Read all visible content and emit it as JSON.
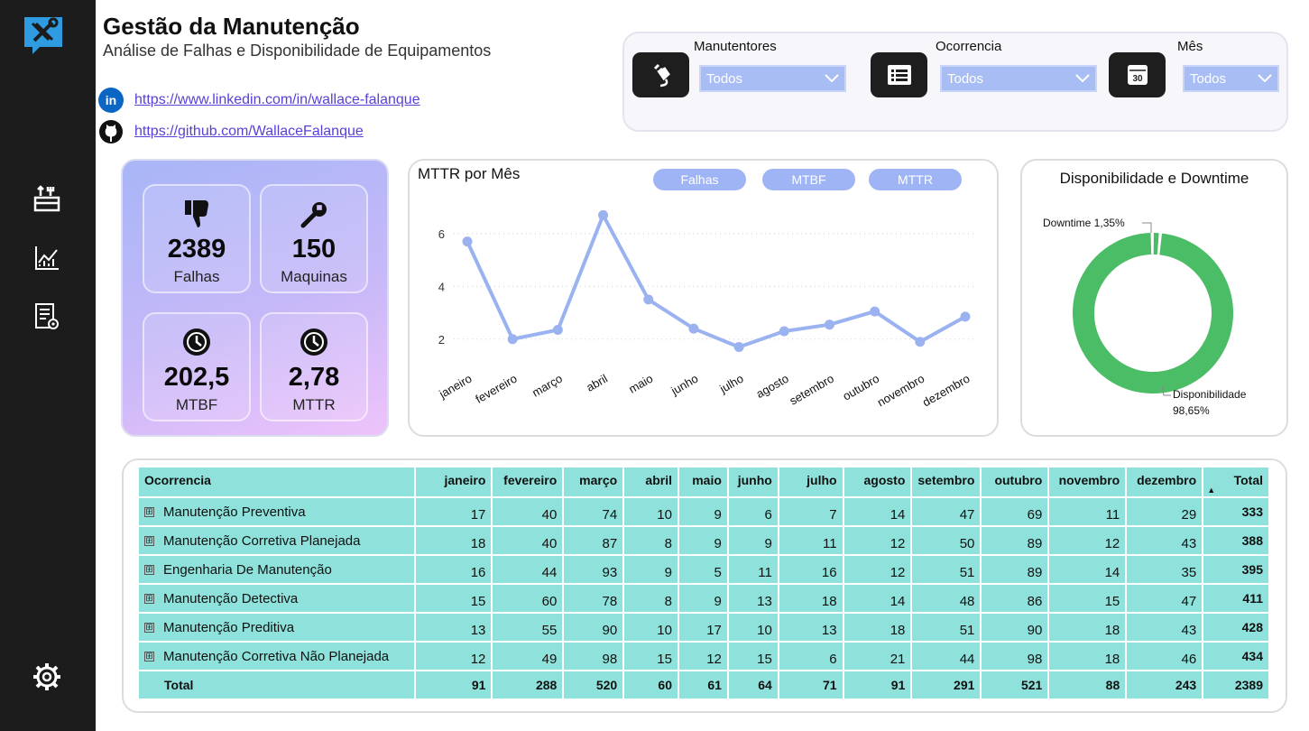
{
  "header": {
    "title": "Gestão da Manutenção",
    "subtitle": "Análise de Falhas e Disponibilidade de Equipamentos",
    "linkedin_url": "https://www.linkedin.com/in/wallace-falanque",
    "github_url": "https://github.com/WallaceFalanque"
  },
  "sidebar": {
    "items": [
      {
        "icon": "tools-icon"
      },
      {
        "icon": "toolbox-icon"
      },
      {
        "icon": "line-chart-icon"
      },
      {
        "icon": "report-settings-icon"
      },
      {
        "icon": "gear-icon"
      }
    ]
  },
  "filters": {
    "manutentores": {
      "label": "Manutentores",
      "value": "Todos"
    },
    "ocorrencia": {
      "label": "Ocorrencia",
      "value": "Todos"
    },
    "mes": {
      "label": "Mês",
      "value": "Todos"
    },
    "calendar_badge": "30"
  },
  "kpis": {
    "falhas": {
      "value": "2389",
      "label": "Falhas"
    },
    "maquinas": {
      "value": "150",
      "label": "Maquinas"
    },
    "mtbf": {
      "value": "202,5",
      "label": "MTBF"
    },
    "mttr": {
      "value": "2,78",
      "label": "MTTR"
    }
  },
  "line_chart": {
    "title": "MTTR por Mês",
    "toggles": [
      "Falhas",
      "MTBF",
      "MTTR"
    ]
  },
  "donut_chart": {
    "title": "Disponibilidade e Downtime",
    "downtime_label": "Downtime 1,35%",
    "disp_label": "Disponibilidade",
    "disp_value": "98,65%",
    "color": "#4cbd67"
  },
  "chart_data": [
    {
      "type": "line",
      "title": "MTTR por Mês",
      "categories": [
        "janeiro",
        "fevereiro",
        "março",
        "abril",
        "maio",
        "junho",
        "julho",
        "agosto",
        "setembro",
        "outubro",
        "novembro",
        "dezembro"
      ],
      "series": [
        {
          "values": [
            5.7,
            2.0,
            2.35,
            6.7,
            3.5,
            2.4,
            1.7,
            2.3,
            2.55,
            3.05,
            1.9,
            2.85
          ]
        }
      ],
      "yticks": [
        2,
        4,
        6
      ],
      "ylim": [
        1,
        7.5
      ],
      "grid": true,
      "color": "#9bb2f0"
    },
    {
      "type": "pie",
      "title": "Disponibilidade e Downtime",
      "labels": [
        "Disponibilidade",
        "Downtime"
      ],
      "values": [
        98.65,
        1.35
      ],
      "colors": [
        "#4cbd67",
        "#4cbd67"
      ]
    }
  ],
  "table": {
    "headers": [
      "Ocorrencia",
      "janeiro",
      "fevereiro",
      "março",
      "abril",
      "maio",
      "junho",
      "julho",
      "agosto",
      "setembro",
      "outubro",
      "novembro",
      "dezembro",
      "Total"
    ],
    "rows": [
      {
        "name": "Manutenção Preventiva",
        "values": [
          "17",
          "40",
          "74",
          "10",
          "9",
          "6",
          "7",
          "14",
          "47",
          "69",
          "11",
          "29"
        ],
        "total": "333"
      },
      {
        "name": "Manutenção Corretiva Planejada",
        "values": [
          "18",
          "40",
          "87",
          "8",
          "9",
          "9",
          "11",
          "12",
          "50",
          "89",
          "12",
          "43"
        ],
        "total": "388"
      },
      {
        "name": "Engenharia De Manutenção",
        "values": [
          "16",
          "44",
          "93",
          "9",
          "5",
          "11",
          "16",
          "12",
          "51",
          "89",
          "14",
          "35"
        ],
        "total": "395"
      },
      {
        "name": "Manutenção Detectiva",
        "values": [
          "15",
          "60",
          "78",
          "8",
          "9",
          "13",
          "18",
          "14",
          "48",
          "86",
          "15",
          "47"
        ],
        "total": "411"
      },
      {
        "name": "Manutenção Preditiva",
        "values": [
          "13",
          "55",
          "90",
          "10",
          "17",
          "10",
          "13",
          "18",
          "51",
          "90",
          "18",
          "43"
        ],
        "total": "428"
      },
      {
        "name": "Manutenção Corretiva Não Planejada",
        "values": [
          "12",
          "49",
          "98",
          "15",
          "12",
          "15",
          "6",
          "21",
          "44",
          "98",
          "18",
          "46"
        ],
        "total": "434"
      }
    ],
    "total_row": {
      "name": "Total",
      "values": [
        "91",
        "288",
        "520",
        "60",
        "61",
        "64",
        "71",
        "91",
        "291",
        "521",
        "88",
        "243"
      ],
      "total": "2389"
    },
    "expander_symbol": "⊞",
    "sort_indicator": "▲"
  }
}
